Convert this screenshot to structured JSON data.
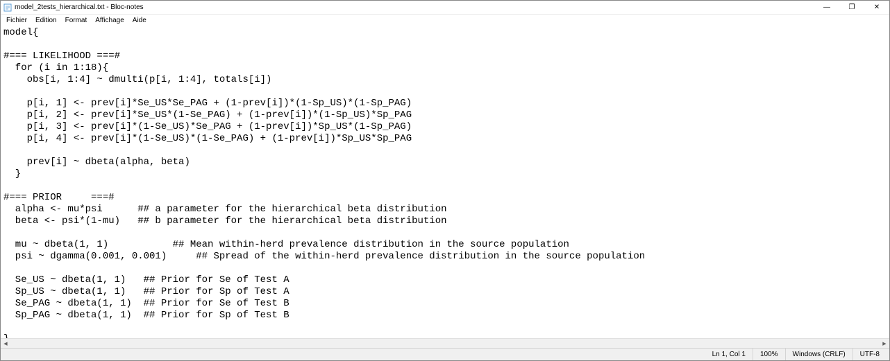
{
  "window": {
    "title": "model_2tests_hierarchical.txt - Bloc-notes",
    "controls": {
      "minimize": "—",
      "maximize": "❐",
      "close": "✕"
    }
  },
  "menu": {
    "items": [
      "Fichier",
      "Edition",
      "Format",
      "Affichage",
      "Aide"
    ]
  },
  "editor": {
    "content": "model{\n\n#=== LIKELIHOOD ===#\n  for (i in 1:18){\n    obs[i, 1:4] ~ dmulti(p[i, 1:4], totals[i])\n\n    p[i, 1] <- prev[i]*Se_US*Se_PAG + (1-prev[i])*(1-Sp_US)*(1-Sp_PAG)\n    p[i, 2] <- prev[i]*Se_US*(1-Se_PAG) + (1-prev[i])*(1-Sp_US)*Sp_PAG\n    p[i, 3] <- prev[i]*(1-Se_US)*Se_PAG + (1-prev[i])*Sp_US*(1-Sp_PAG)\n    p[i, 4] <- prev[i]*(1-Se_US)*(1-Se_PAG) + (1-prev[i])*Sp_US*Sp_PAG\n\n    prev[i] ~ dbeta(alpha, beta)\n  }\n\n#=== PRIOR     ===#\n  alpha <- mu*psi      ## a parameter for the hierarchical beta distribution\n  beta <- psi*(1-mu)   ## b parameter for the hierarchical beta distribution\n\n  mu ~ dbeta(1, 1)           ## Mean within-herd prevalence distribution in the source population\n  psi ~ dgamma(0.001, 0.001)     ## Spread of the within-herd prevalence distribution in the source population\n\n  Se_US ~ dbeta(1, 1)   ## Prior for Se of Test A\n  Sp_US ~ dbeta(1, 1)   ## Prior for Sp of Test A\n  Se_PAG ~ dbeta(1, 1)  ## Prior for Se of Test B\n  Sp_PAG ~ dbeta(1, 1)  ## Prior for Sp of Test B\n\n}"
  },
  "statusbar": {
    "position": "Ln 1, Col 1",
    "zoom": "100%",
    "line_ending": "Windows (CRLF)",
    "encoding": "UTF-8"
  }
}
